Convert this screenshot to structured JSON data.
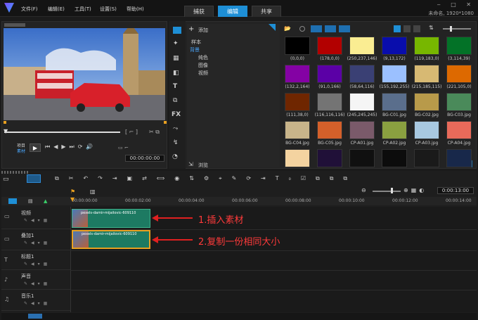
{
  "menu": [
    "文件(F)",
    "编辑(E)",
    "工具(T)",
    "设置(S)",
    "帮助(H)"
  ],
  "tabs": [
    "捕获",
    "编辑",
    "共享"
  ],
  "window_info": "未命名, 1920*1080",
  "preview": {
    "label": "项目",
    "label2": "素材",
    "timecode": "00:00:00:00"
  },
  "library": {
    "add": "添加",
    "browse": "浏览",
    "tree": [
      "样本",
      "背景",
      "纯色",
      "图像",
      "视频"
    ]
  },
  "tiles": [
    {
      "label": "(0,0,0)",
      "color": "#000000"
    },
    {
      "label": "(178,0,0)",
      "color": "#b20000"
    },
    {
      "label": "(250,237,146)",
      "color": "#faed92"
    },
    {
      "label": "(9,13,172)",
      "color": "#090dac"
    },
    {
      "label": "(119,183,0)",
      "color": "#77b700"
    },
    {
      "label": "(3,114,39)",
      "color": "#037227"
    },
    {
      "label": "(132,2,164)",
      "color": "#8402a4"
    },
    {
      "label": "(91,0,166)",
      "color": "#5b00a6"
    },
    {
      "label": "(58,64,116)",
      "color": "#3a4074"
    },
    {
      "label": "(155,192,255)",
      "color": "#9bc0ff"
    },
    {
      "label": "(215,185,115)",
      "color": "#d7b973"
    },
    {
      "label": "(221,105,0)",
      "color": "#dd6900"
    },
    {
      "label": "(111,38,0)",
      "color": "#6f2600"
    },
    {
      "label": "(116,116,116)",
      "color": "#747474"
    },
    {
      "label": "(245,245,245)",
      "color": "#f5f5f5"
    },
    {
      "label": "BG-C01.jpg",
      "color": "#5a6e8c"
    },
    {
      "label": "BG-C02.jpg",
      "color": "#b89a4a"
    },
    {
      "label": "BG-C03.jpg",
      "color": "#4a8a5a"
    },
    {
      "label": "BG-C04.jpg",
      "color": "#c8b48a"
    },
    {
      "label": "BG-C05.jpg",
      "color": "#d4602a"
    },
    {
      "label": "CP-A01.jpg",
      "color": "#7a5a6a"
    },
    {
      "label": "CP-A02.jpg",
      "color": "#8aa040"
    },
    {
      "label": "CP-A03.jpg",
      "color": "#a8c8e0"
    },
    {
      "label": "CP-A04.jpg",
      "color": "#e86a5a"
    },
    {
      "label": "",
      "color": "#f4d3a0"
    },
    {
      "label": "",
      "color": "#201038"
    },
    {
      "label": "",
      "color": "#101010"
    },
    {
      "label": "",
      "color": "#0c0c0c"
    },
    {
      "label": "",
      "color": "#1a1a1a"
    },
    {
      "label": "",
      "color": "#18284a"
    }
  ],
  "timeline": {
    "ruler": [
      "00:00:00:00",
      "00:00:02:00",
      "00:00:04:00",
      "00:00:06:00",
      "00:00:08:00",
      "00:00:10:00",
      "00:00:12:00",
      "00:00:14:00"
    ],
    "timecode": "0:00:13:00",
    "tracks": [
      "视频",
      "叠加1",
      "标题1",
      "声音",
      "音乐1"
    ],
    "clip_name": "pexels-damir-mijailovic-609110"
  },
  "annotations": [
    "1.插入素材",
    "2.复制一份相同大小"
  ]
}
